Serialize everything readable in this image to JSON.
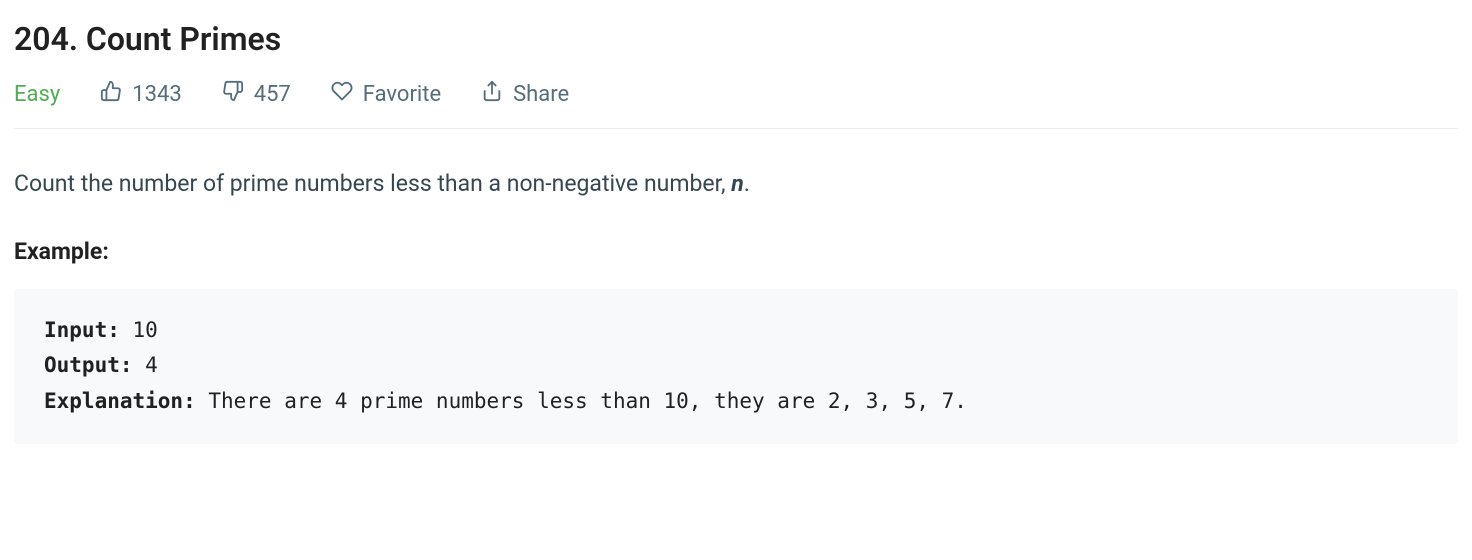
{
  "title": "204. Count Primes",
  "meta": {
    "difficulty": "Easy",
    "likes": "1343",
    "dislikes": "457",
    "favorite_label": "Favorite",
    "share_label": "Share"
  },
  "description": {
    "text_prefix": "Count the number of prime numbers less than a non-negative number, ",
    "variable": "n",
    "text_suffix": "."
  },
  "example": {
    "heading": "Example:",
    "input_label": "Input:",
    "input_value": " 10",
    "output_label": "Output:",
    "output_value": " 4",
    "explanation_label": "Explanation:",
    "explanation_value": " There are 4 prime numbers less than 10, they are 2, 3, 5, 7."
  }
}
